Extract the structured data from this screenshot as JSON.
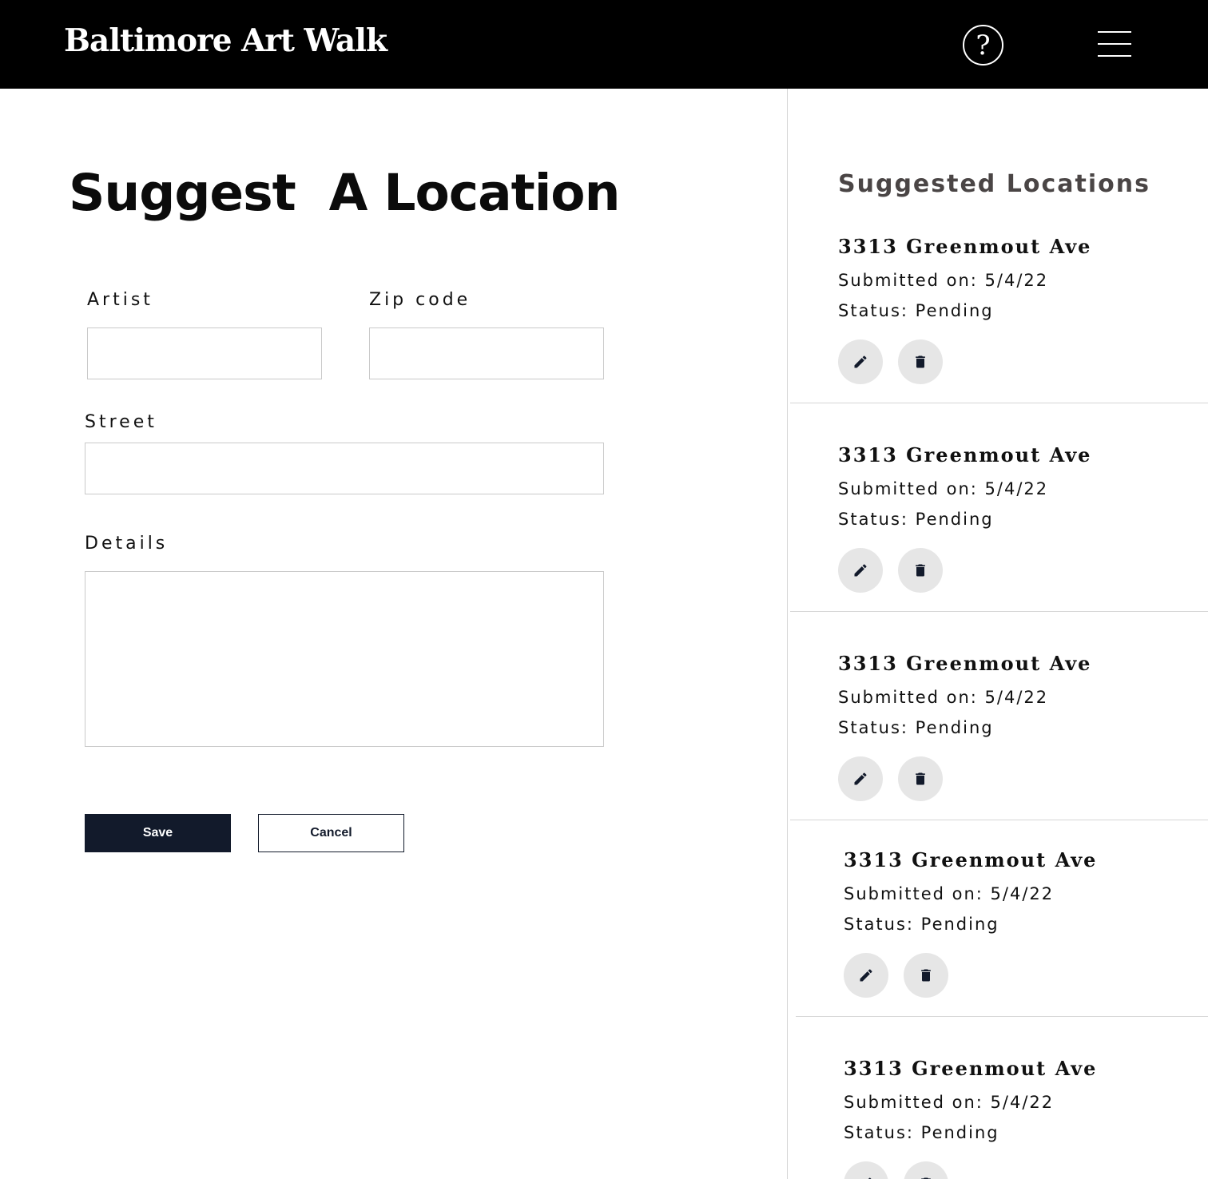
{
  "header": {
    "brand": "Baltimore Art Walk",
    "help_glyph": "?"
  },
  "form": {
    "title": "Suggest  A Location",
    "artist_label": "Artist",
    "artist_value": "",
    "zip_label": "Zip code",
    "zip_value": "",
    "street_label": "Street",
    "street_value": "",
    "details_label": "Details",
    "details_value": "",
    "save_label": "Save",
    "cancel_label": "Cancel"
  },
  "sidebar": {
    "title": "Suggested Locations",
    "items": [
      {
        "street": "3313 Greenmout Ave",
        "submitted": "Submitted on: 5/4/22",
        "status": "Status: Pending"
      },
      {
        "street": "3313 Greenmout Ave",
        "submitted": "Submitted on: 5/4/22",
        "status": "Status: Pending"
      },
      {
        "street": "3313 Greenmout Ave",
        "submitted": "Submitted on: 5/4/22",
        "status": "Status: Pending"
      },
      {
        "street": "3313 Greenmout Ave",
        "submitted": "Submitted on: 5/4/22",
        "status": "Status: Pending"
      },
      {
        "street": "3313 Greenmout Ave",
        "submitted": "Submitted on: 5/4/22",
        "status": "Status: Pending"
      }
    ]
  },
  "icons": {
    "edit": "pencil-icon",
    "delete": "trash-icon",
    "help": "question-icon",
    "menu": "hamburger-icon"
  },
  "colors": {
    "header_bg": "#000000",
    "primary": "#121a2b",
    "icon_button_bg": "#e6e6e6",
    "sidebar_title": "#4a4545"
  }
}
